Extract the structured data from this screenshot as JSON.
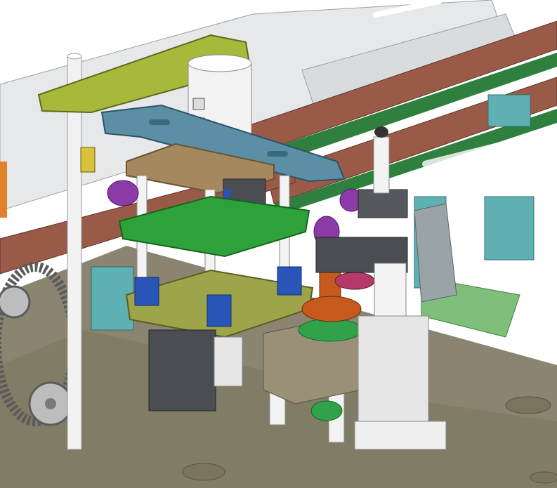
{
  "scene": {
    "description_kind": "cad-assembly-render",
    "colors": {
      "background": "#ffffff",
      "base_plate": "#8a8470",
      "base_plate_dark": "#6f6a59",
      "frame_white": "#e6e8ea",
      "conveyor_rail_brown": "#9a5a48",
      "conveyor_green": "#2f7f3e",
      "top_arm_yellow_green": "#a7b83a",
      "blue_arm": "#5a8fa6",
      "tan_plate": "#a6885e",
      "green_plate": "#2ea23a",
      "olive_plate": "#9ea44a",
      "blue_bushing": "#2a55b8",
      "purple_part": "#8b3aa8",
      "orange_part": "#c65a1d",
      "teal_bracket": "#5fb0b3",
      "gray_motor": "#4a4d52",
      "chain_gray": "#5b5b5b",
      "gray_block": "#6e6e72",
      "pink_part": "#b53a6a"
    },
    "icons": [
      "cylinder-icon",
      "bolt-icon",
      "gear-icon",
      "chain-icon"
    ]
  }
}
